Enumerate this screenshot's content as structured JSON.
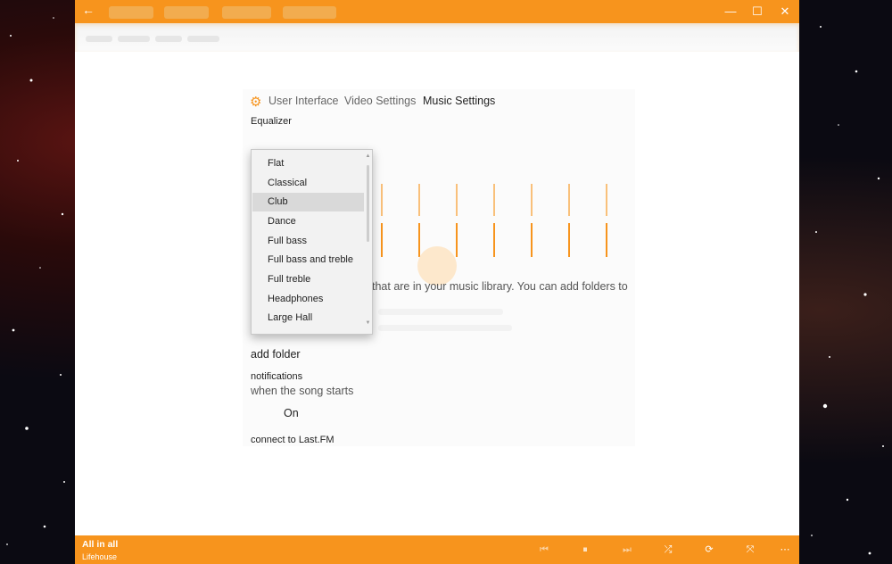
{
  "titlebar": {
    "back_icon": "back-arrow-icon",
    "minimize_glyph": "—",
    "maximize_glyph": "☐",
    "close_glyph": "✕",
    "color": "#f7941d"
  },
  "settings": {
    "tabs": [
      {
        "label": "User Interface"
      },
      {
        "label": "Video Settings"
      },
      {
        "label": "Music Settings"
      }
    ],
    "equalizer_label": "Equalizer",
    "library_text": "that are in your music library. You can add folders to",
    "add_folder_label": "add folder",
    "notifications_label": "notifications",
    "song_starts_label": "when the song starts",
    "toggle_state": "On",
    "lastfm_label": "connect to Last.FM"
  },
  "equalizer_presets": {
    "options": [
      "Flat",
      "Classical",
      "Club",
      "Dance",
      "Full bass",
      "Full bass and treble",
      "Full treble",
      "Headphones",
      "Large Hall"
    ],
    "selected": "Club"
  },
  "player": {
    "title": "All in all",
    "artist": "Lifehouse",
    "controls": {
      "previous": "⏮",
      "play_pause": "⏸",
      "next": "⏭",
      "shuffle": "⤮",
      "repeat": "⟳",
      "fullscreen": "⤧",
      "more": "⋯"
    }
  }
}
